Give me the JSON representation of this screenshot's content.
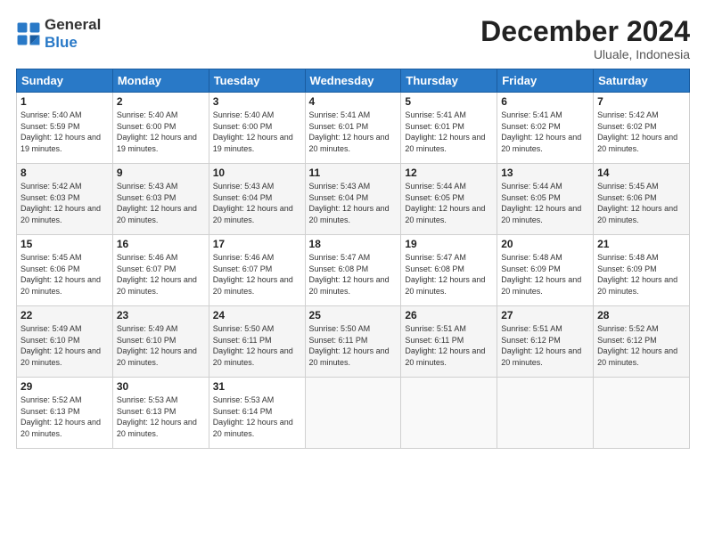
{
  "header": {
    "logo_general": "General",
    "logo_blue": "Blue",
    "month_title": "December 2024",
    "location": "Uluale, Indonesia"
  },
  "days_of_week": [
    "Sunday",
    "Monday",
    "Tuesday",
    "Wednesday",
    "Thursday",
    "Friday",
    "Saturday"
  ],
  "weeks": [
    [
      {
        "day": "1",
        "sunrise": "Sunrise: 5:40 AM",
        "sunset": "Sunset: 5:59 PM",
        "daylight": "Daylight: 12 hours and 19 minutes."
      },
      {
        "day": "2",
        "sunrise": "Sunrise: 5:40 AM",
        "sunset": "Sunset: 6:00 PM",
        "daylight": "Daylight: 12 hours and 19 minutes."
      },
      {
        "day": "3",
        "sunrise": "Sunrise: 5:40 AM",
        "sunset": "Sunset: 6:00 PM",
        "daylight": "Daylight: 12 hours and 19 minutes."
      },
      {
        "day": "4",
        "sunrise": "Sunrise: 5:41 AM",
        "sunset": "Sunset: 6:01 PM",
        "daylight": "Daylight: 12 hours and 20 minutes."
      },
      {
        "day": "5",
        "sunrise": "Sunrise: 5:41 AM",
        "sunset": "Sunset: 6:01 PM",
        "daylight": "Daylight: 12 hours and 20 minutes."
      },
      {
        "day": "6",
        "sunrise": "Sunrise: 5:41 AM",
        "sunset": "Sunset: 6:02 PM",
        "daylight": "Daylight: 12 hours and 20 minutes."
      },
      {
        "day": "7",
        "sunrise": "Sunrise: 5:42 AM",
        "sunset": "Sunset: 6:02 PM",
        "daylight": "Daylight: 12 hours and 20 minutes."
      }
    ],
    [
      {
        "day": "8",
        "sunrise": "Sunrise: 5:42 AM",
        "sunset": "Sunset: 6:03 PM",
        "daylight": "Daylight: 12 hours and 20 minutes."
      },
      {
        "day": "9",
        "sunrise": "Sunrise: 5:43 AM",
        "sunset": "Sunset: 6:03 PM",
        "daylight": "Daylight: 12 hours and 20 minutes."
      },
      {
        "day": "10",
        "sunrise": "Sunrise: 5:43 AM",
        "sunset": "Sunset: 6:04 PM",
        "daylight": "Daylight: 12 hours and 20 minutes."
      },
      {
        "day": "11",
        "sunrise": "Sunrise: 5:43 AM",
        "sunset": "Sunset: 6:04 PM",
        "daylight": "Daylight: 12 hours and 20 minutes."
      },
      {
        "day": "12",
        "sunrise": "Sunrise: 5:44 AM",
        "sunset": "Sunset: 6:05 PM",
        "daylight": "Daylight: 12 hours and 20 minutes."
      },
      {
        "day": "13",
        "sunrise": "Sunrise: 5:44 AM",
        "sunset": "Sunset: 6:05 PM",
        "daylight": "Daylight: 12 hours and 20 minutes."
      },
      {
        "day": "14",
        "sunrise": "Sunrise: 5:45 AM",
        "sunset": "Sunset: 6:06 PM",
        "daylight": "Daylight: 12 hours and 20 minutes."
      }
    ],
    [
      {
        "day": "15",
        "sunrise": "Sunrise: 5:45 AM",
        "sunset": "Sunset: 6:06 PM",
        "daylight": "Daylight: 12 hours and 20 minutes."
      },
      {
        "day": "16",
        "sunrise": "Sunrise: 5:46 AM",
        "sunset": "Sunset: 6:07 PM",
        "daylight": "Daylight: 12 hours and 20 minutes."
      },
      {
        "day": "17",
        "sunrise": "Sunrise: 5:46 AM",
        "sunset": "Sunset: 6:07 PM",
        "daylight": "Daylight: 12 hours and 20 minutes."
      },
      {
        "day": "18",
        "sunrise": "Sunrise: 5:47 AM",
        "sunset": "Sunset: 6:08 PM",
        "daylight": "Daylight: 12 hours and 20 minutes."
      },
      {
        "day": "19",
        "sunrise": "Sunrise: 5:47 AM",
        "sunset": "Sunset: 6:08 PM",
        "daylight": "Daylight: 12 hours and 20 minutes."
      },
      {
        "day": "20",
        "sunrise": "Sunrise: 5:48 AM",
        "sunset": "Sunset: 6:09 PM",
        "daylight": "Daylight: 12 hours and 20 minutes."
      },
      {
        "day": "21",
        "sunrise": "Sunrise: 5:48 AM",
        "sunset": "Sunset: 6:09 PM",
        "daylight": "Daylight: 12 hours and 20 minutes."
      }
    ],
    [
      {
        "day": "22",
        "sunrise": "Sunrise: 5:49 AM",
        "sunset": "Sunset: 6:10 PM",
        "daylight": "Daylight: 12 hours and 20 minutes."
      },
      {
        "day": "23",
        "sunrise": "Sunrise: 5:49 AM",
        "sunset": "Sunset: 6:10 PM",
        "daylight": "Daylight: 12 hours and 20 minutes."
      },
      {
        "day": "24",
        "sunrise": "Sunrise: 5:50 AM",
        "sunset": "Sunset: 6:11 PM",
        "daylight": "Daylight: 12 hours and 20 minutes."
      },
      {
        "day": "25",
        "sunrise": "Sunrise: 5:50 AM",
        "sunset": "Sunset: 6:11 PM",
        "daylight": "Daylight: 12 hours and 20 minutes."
      },
      {
        "day": "26",
        "sunrise": "Sunrise: 5:51 AM",
        "sunset": "Sunset: 6:11 PM",
        "daylight": "Daylight: 12 hours and 20 minutes."
      },
      {
        "day": "27",
        "sunrise": "Sunrise: 5:51 AM",
        "sunset": "Sunset: 6:12 PM",
        "daylight": "Daylight: 12 hours and 20 minutes."
      },
      {
        "day": "28",
        "sunrise": "Sunrise: 5:52 AM",
        "sunset": "Sunset: 6:12 PM",
        "daylight": "Daylight: 12 hours and 20 minutes."
      }
    ],
    [
      {
        "day": "29",
        "sunrise": "Sunrise: 5:52 AM",
        "sunset": "Sunset: 6:13 PM",
        "daylight": "Daylight: 12 hours and 20 minutes."
      },
      {
        "day": "30",
        "sunrise": "Sunrise: 5:53 AM",
        "sunset": "Sunset: 6:13 PM",
        "daylight": "Daylight: 12 hours and 20 minutes."
      },
      {
        "day": "31",
        "sunrise": "Sunrise: 5:53 AM",
        "sunset": "Sunset: 6:14 PM",
        "daylight": "Daylight: 12 hours and 20 minutes."
      },
      {
        "day": "",
        "sunrise": "",
        "sunset": "",
        "daylight": ""
      },
      {
        "day": "",
        "sunrise": "",
        "sunset": "",
        "daylight": ""
      },
      {
        "day": "",
        "sunrise": "",
        "sunset": "",
        "daylight": ""
      },
      {
        "day": "",
        "sunrise": "",
        "sunset": "",
        "daylight": ""
      }
    ]
  ]
}
